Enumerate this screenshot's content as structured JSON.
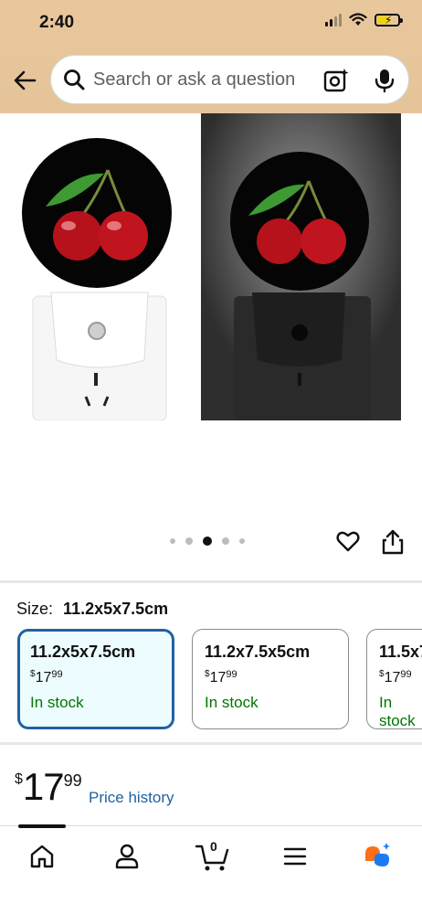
{
  "status_bar": {
    "time": "2:40"
  },
  "search": {
    "placeholder": "Search or ask a question"
  },
  "gallery": {
    "dot_count": 5,
    "active_dot_index": 2
  },
  "size_selector": {
    "label": "Size:",
    "selected_value": "11.2x5x7.5cm",
    "options": [
      {
        "name": "11.2x5x7.5cm",
        "price_symbol": "$",
        "price_whole": "17",
        "price_fraction": "99",
        "availability": "In stock",
        "selected": true
      },
      {
        "name": "11.2x7.5x5cm",
        "price_symbol": "$",
        "price_whole": "17",
        "price_fraction": "99",
        "availability": "In stock",
        "selected": false
      },
      {
        "name": "11.5x7",
        "price_symbol": "$",
        "price_whole": "17",
        "price_fraction": "99",
        "availability": "In stock",
        "selected": false
      }
    ]
  },
  "price": {
    "symbol": "$",
    "whole": "17",
    "fraction": "99",
    "history_link": "Price history"
  },
  "bottom_nav": {
    "cart_count": "0",
    "items": [
      "home-icon",
      "account-icon",
      "cart-icon",
      "menu-icon",
      "rufus-ai-icon"
    ]
  },
  "colors": {
    "header_background": "#e6c49a",
    "link_blue": "#2162a1",
    "in_stock_green": "#007600",
    "selected_border": "#2162a1",
    "selected_background": "#edfdff"
  }
}
